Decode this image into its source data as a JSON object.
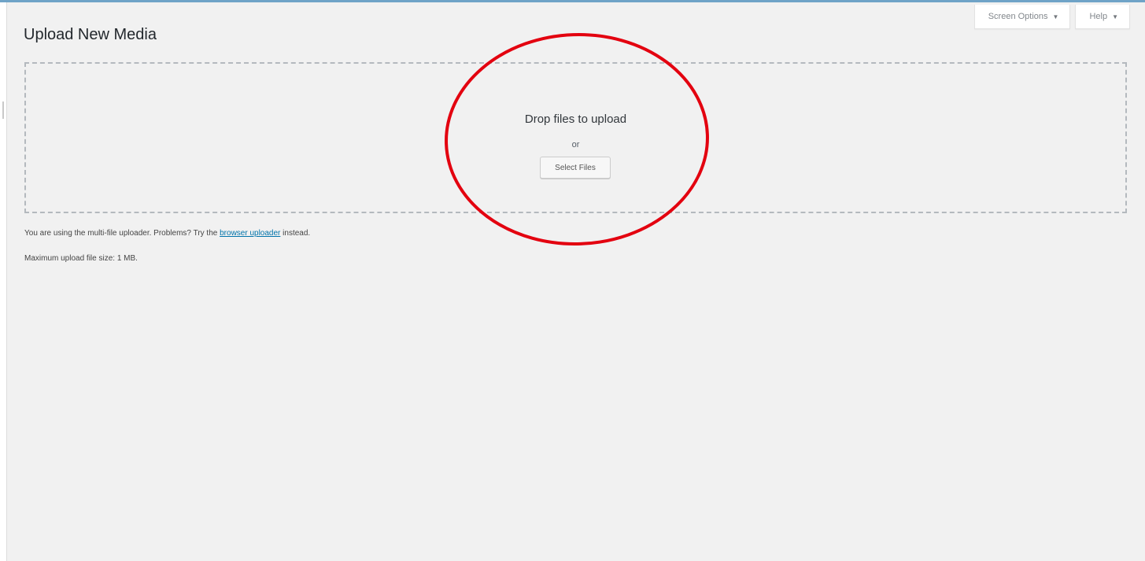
{
  "page": {
    "title": "Upload New Media"
  },
  "screen_meta": {
    "screen_options_label": "Screen Options",
    "help_label": "Help",
    "caret_glyph": "▼"
  },
  "uploader": {
    "drop_instructions": "Drop files to upload",
    "or_text": "or",
    "select_button_label": "Select Files"
  },
  "info": {
    "multi_file_prefix": "You are using the multi-file uploader. Problems? Try the",
    "browser_uploader_link": "browser uploader",
    "multi_file_suffix": "instead.",
    "max_size_text": "Maximum upload file size: 1 MB."
  },
  "annotation": {
    "shape": "ellipse",
    "color": "#e3000f"
  },
  "colors": {
    "background": "#f1f1f1",
    "link": "#0073aa",
    "admin_top_edge": "#6fa3c7"
  }
}
